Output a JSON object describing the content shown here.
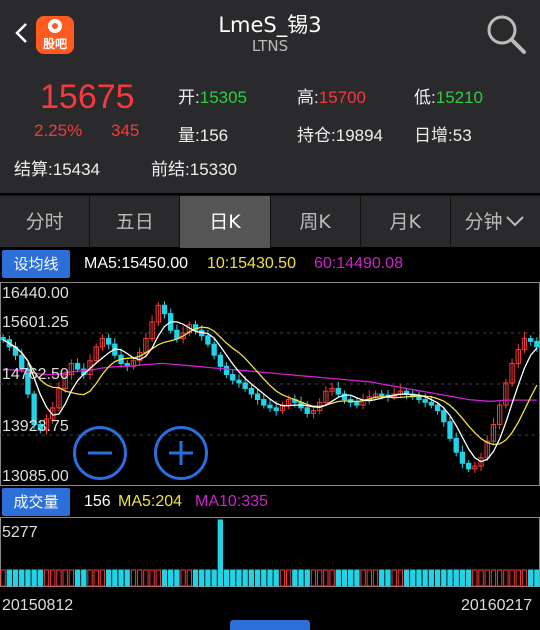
{
  "header": {
    "logo_text": "股吧",
    "title": "LmeS_锡3",
    "subtitle": "LTNS"
  },
  "quote": {
    "price": "15675",
    "change_pct": "2.25%",
    "change": "345",
    "open_label": "开:",
    "open": "15305",
    "high_label": "高:",
    "high": "15700",
    "low_label": "低:",
    "low": "15210",
    "volume_label": "量:",
    "volume": "156",
    "position_label": "持仓:",
    "position": "19894",
    "daily_inc_label": "日增:",
    "daily_inc": "53",
    "settle_label": "结算:",
    "settle": "15434",
    "prev_settle_label": "前结:",
    "prev_settle": "15330"
  },
  "tabs": [
    {
      "label": "分时"
    },
    {
      "label": "五日"
    },
    {
      "label": "日K"
    },
    {
      "label": "周K"
    },
    {
      "label": "月K"
    },
    {
      "label": "分钟"
    }
  ],
  "ma_bar": {
    "button": "设均线",
    "ma5": "MA5:15450.00",
    "ma10": "10:15430.50",
    "ma60": "60:14490.08"
  },
  "vol_bar": {
    "button": "成交量",
    "value": "156",
    "ma5": "MA5:204",
    "ma10": "MA10:335"
  },
  "colors": {
    "up": "#f43a3a",
    "down": "#22d3e6",
    "ma5": "#ffffff",
    "ma10": "#f0e040",
    "ma60": "#d020d0",
    "accent": "#2d6fd8"
  },
  "chart_data": {
    "type": "candlestick",
    "price_axis_labels": [
      "16440.00",
      "15601.25",
      "14762.50",
      "13923.75",
      "13085.00"
    ],
    "ylim": [
      13085,
      16440
    ],
    "volume_axis_label": "5277",
    "date_start": "20150812",
    "date_end": "20160217",
    "close_series": [
      15580,
      15450,
      15300,
      15050,
      14600,
      14050,
      13950,
      14150,
      14350,
      14700,
      14950,
      15150,
      15050,
      14950,
      15200,
      15450,
      15600,
      15500,
      15300,
      15150,
      15100,
      15200,
      15350,
      15600,
      15900,
      16200,
      16050,
      15750,
      15600,
      15700,
      15850,
      15750,
      15650,
      15500,
      15300,
      15100,
      14950,
      14850,
      14800,
      14700,
      14600,
      14500,
      14400,
      14350,
      14300,
      14400,
      14500,
      14450,
      14350,
      14250,
      14300,
      14450,
      14650,
      14700,
      14600,
      14500,
      14450,
      14400,
      14500,
      14550,
      14600,
      14580,
      14550,
      14600,
      14650,
      14600,
      14550,
      14500,
      14450,
      14400,
      14300,
      14100,
      13800,
      13550,
      13350,
      13250,
      13300,
      13450,
      13750,
      14050,
      14400,
      14800,
      15150,
      15400,
      15600,
      15550,
      15450
    ],
    "volume_series": [
      90,
      80,
      85,
      120,
      110,
      95,
      80,
      70,
      85,
      90,
      100,
      95,
      85,
      80,
      75,
      85,
      95,
      100,
      90,
      85,
      80,
      75,
      90,
      100,
      110,
      120,
      100,
      90,
      80,
      85,
      95,
      90,
      85,
      80,
      75,
      5277,
      95,
      90,
      85,
      80,
      75,
      80,
      85,
      70,
      75,
      80,
      70,
      65,
      70,
      75,
      80,
      85,
      75,
      70,
      65,
      70,
      75,
      80,
      70,
      65,
      70,
      75,
      70,
      65,
      60,
      70,
      75,
      80,
      85,
      90,
      95,
      100,
      110,
      120,
      105,
      95,
      90,
      100,
      110,
      120,
      115,
      105,
      100,
      95,
      90,
      85,
      80
    ],
    "ma60_series": [
      15050,
      15040,
      15030,
      15020,
      15000,
      14980,
      14960,
      14950,
      14950,
      14960,
      14980,
      15000,
      15010,
      15020,
      15030,
      15050,
      15070,
      15080,
      15090,
      15100,
      15100,
      15110,
      15120,
      15130,
      15140,
      15150,
      15150,
      15140,
      15130,
      15120,
      15110,
      15100,
      15090,
      15080,
      15070,
      15060,
      15050,
      15040,
      15030,
      15020,
      15010,
      15000,
      14990,
      14980,
      14970,
      14960,
      14950,
      14940,
      14930,
      14920,
      14910,
      14900,
      14890,
      14880,
      14870,
      14860,
      14850,
      14840,
      14830,
      14820,
      14800,
      14780,
      14760,
      14740,
      14720,
      14700,
      14680,
      14660,
      14640,
      14620,
      14600,
      14580,
      14560,
      14540,
      14520,
      14500,
      14490,
      14480,
      14470,
      14470,
      14480,
      14490,
      14490,
      14490,
      14490,
      14490,
      14490
    ]
  }
}
